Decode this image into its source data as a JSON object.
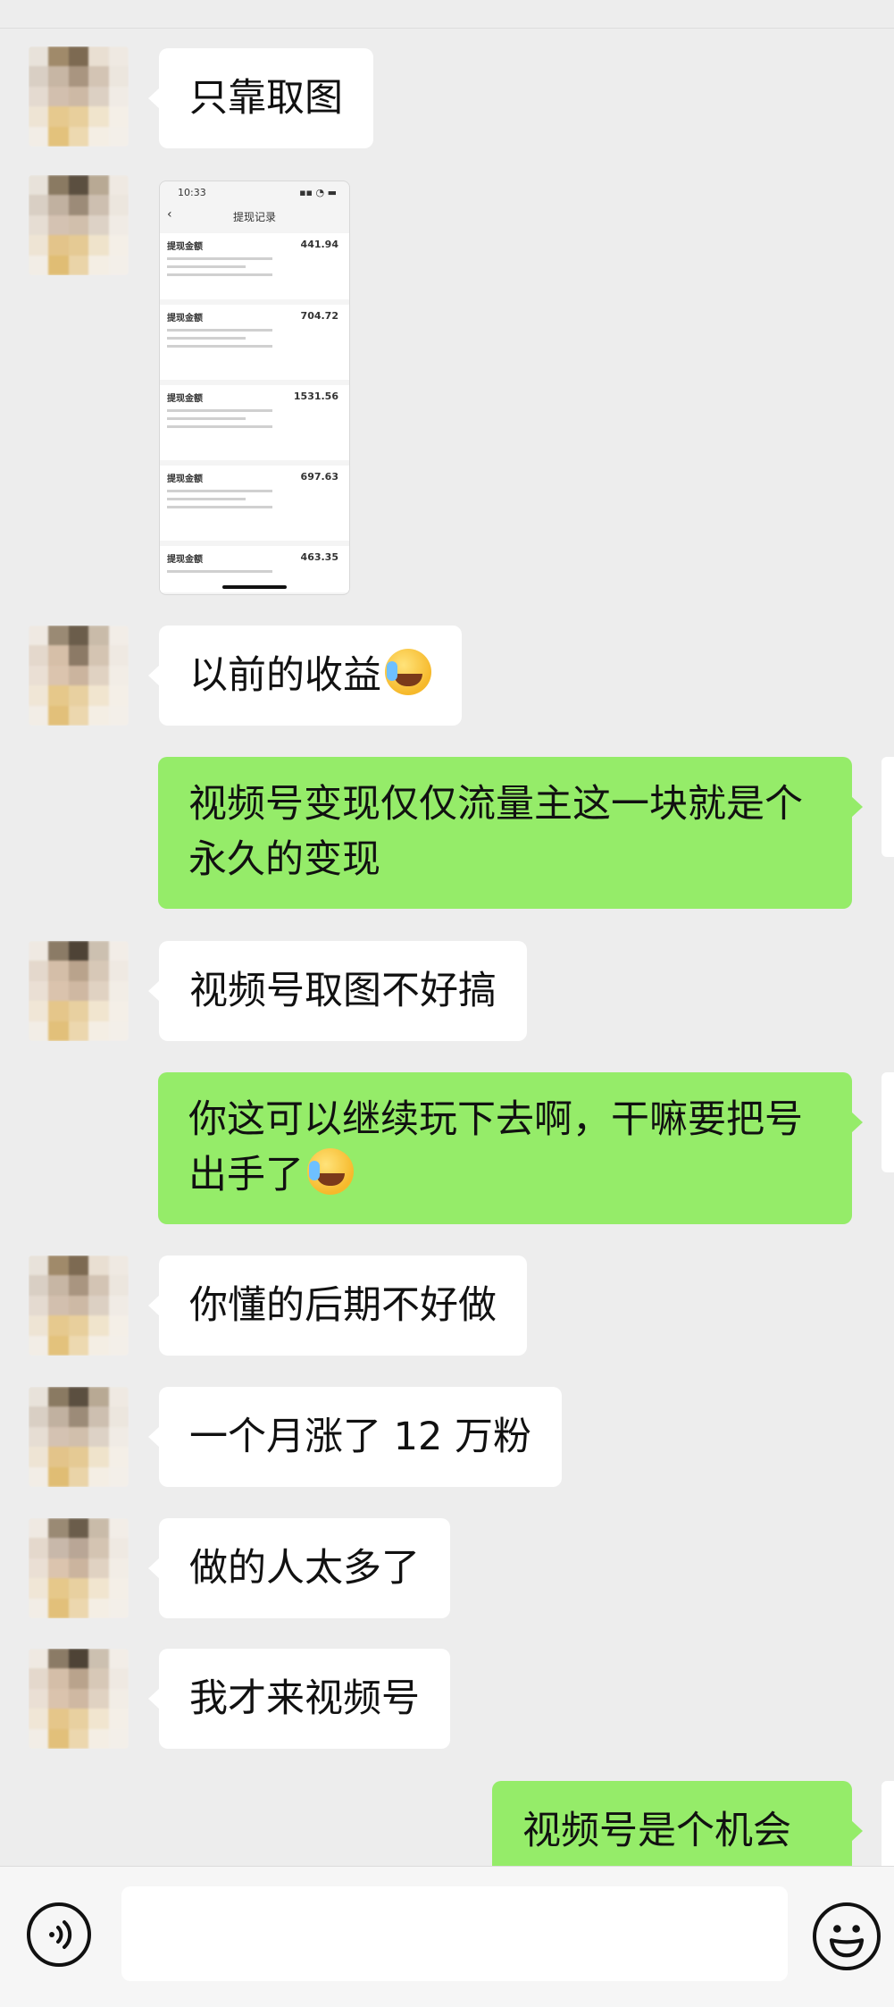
{
  "chat": {
    "messages": [
      {
        "side": "left",
        "text": "只靠取图"
      },
      {
        "side": "left",
        "type": "image"
      },
      {
        "side": "left",
        "text": "以前的收益"
      },
      {
        "side": "right",
        "text": "视频号变现仅仅流量主这一块就是个永久的变现"
      },
      {
        "side": "left",
        "text": "视频号取图不好搞"
      },
      {
        "side": "right",
        "text": "你这可以继续玩下去啊，干嘛要把号出手了"
      },
      {
        "side": "left",
        "text": "你懂的后期不好做"
      },
      {
        "side": "left",
        "text": "一个月涨了 12 万粉"
      },
      {
        "side": "left",
        "text": "做的人太多了"
      },
      {
        "side": "left",
        "text": "我才来视频号"
      },
      {
        "side": "right",
        "text": "视频号是个机会"
      }
    ]
  },
  "thumbnail": {
    "time": "10:33",
    "title": "提现记录",
    "cards": [
      {
        "label": "提现金额",
        "amount": "441.94"
      },
      {
        "label": "提现金额",
        "amount": "704.72"
      },
      {
        "label": "提现金额",
        "amount": "1531.56"
      },
      {
        "label": "提现金额",
        "amount": "697.63"
      },
      {
        "label": "提现金额",
        "amount": "463.35"
      }
    ]
  },
  "input": {
    "value": ""
  }
}
